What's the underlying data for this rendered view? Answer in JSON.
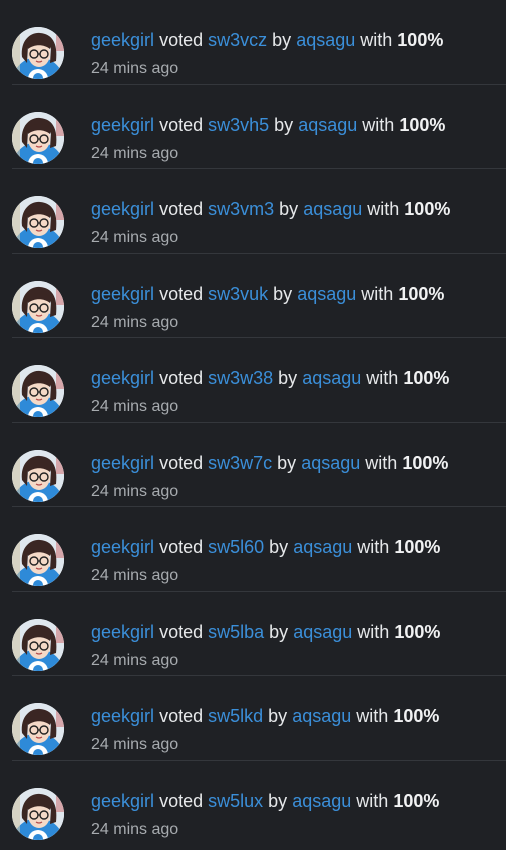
{
  "activity": {
    "items": [
      {
        "voter": "geekgirl",
        "action": "voted",
        "post": "sw3vcz",
        "by_word": "by",
        "author": "aqsagu",
        "with_word": "with",
        "weight": "100%",
        "time": "24 mins ago"
      },
      {
        "voter": "geekgirl",
        "action": "voted",
        "post": "sw3vh5",
        "by_word": "by",
        "author": "aqsagu",
        "with_word": "with",
        "weight": "100%",
        "time": "24 mins ago"
      },
      {
        "voter": "geekgirl",
        "action": "voted",
        "post": "sw3vm3",
        "by_word": "by",
        "author": "aqsagu",
        "with_word": "with",
        "weight": "100%",
        "time": "24 mins ago"
      },
      {
        "voter": "geekgirl",
        "action": "voted",
        "post": "sw3vuk",
        "by_word": "by",
        "author": "aqsagu",
        "with_word": "with",
        "weight": "100%",
        "time": "24 mins ago"
      },
      {
        "voter": "geekgirl",
        "action": "voted",
        "post": "sw3w38",
        "by_word": "by",
        "author": "aqsagu",
        "with_word": "with",
        "weight": "100%",
        "time": "24 mins ago"
      },
      {
        "voter": "geekgirl",
        "action": "voted",
        "post": "sw3w7c",
        "by_word": "by",
        "author": "aqsagu",
        "with_word": "with",
        "weight": "100%",
        "time": "24 mins ago"
      },
      {
        "voter": "geekgirl",
        "action": "voted",
        "post": "sw5l60",
        "by_word": "by",
        "author": "aqsagu",
        "with_word": "with",
        "weight": "100%",
        "time": "24 mins ago"
      },
      {
        "voter": "geekgirl",
        "action": "voted",
        "post": "sw5lba",
        "by_word": "by",
        "author": "aqsagu",
        "with_word": "with",
        "weight": "100%",
        "time": "24 mins ago"
      },
      {
        "voter": "geekgirl",
        "action": "voted",
        "post": "sw5lkd",
        "by_word": "by",
        "author": "aqsagu",
        "with_word": "with",
        "weight": "100%",
        "time": "24 mins ago"
      },
      {
        "voter": "geekgirl",
        "action": "voted",
        "post": "sw5lux",
        "by_word": "by",
        "author": "aqsagu",
        "with_word": "with",
        "weight": "100%",
        "time": "24 mins ago"
      }
    ]
  }
}
